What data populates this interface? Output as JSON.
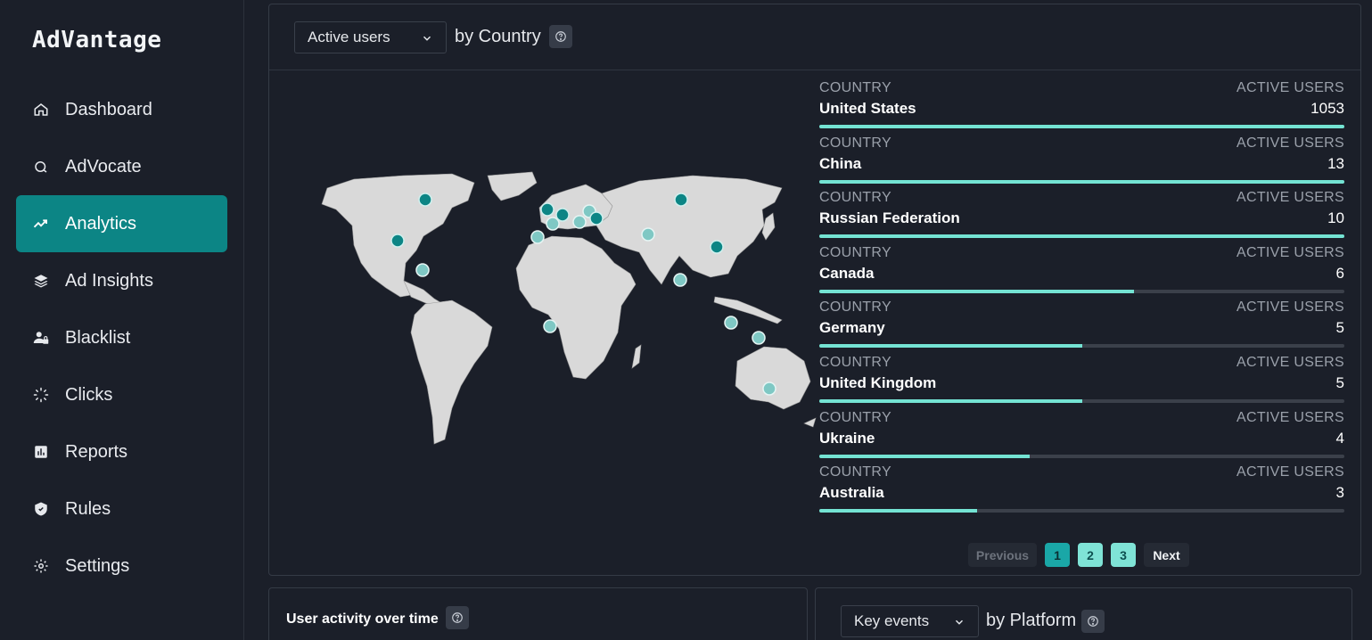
{
  "app": {
    "name": "AdVantage"
  },
  "sidebar": {
    "items": [
      {
        "label": "Dashboard",
        "icon": "home-icon"
      },
      {
        "label": "AdVocate",
        "icon": "chat-icon"
      },
      {
        "label": "Analytics",
        "icon": "trend-icon",
        "active": true
      },
      {
        "label": "Ad Insights",
        "icon": "layers-icon"
      },
      {
        "label": "Blacklist",
        "icon": "user-lock-icon"
      },
      {
        "label": "Clicks",
        "icon": "spinner-icon"
      },
      {
        "label": "Reports",
        "icon": "bar-chart-icon"
      },
      {
        "label": "Rules",
        "icon": "shield-icon"
      },
      {
        "label": "Settings",
        "icon": "gear-icon"
      }
    ]
  },
  "country_panel": {
    "metric_selected": "Active users",
    "by_label": "by Country",
    "col_country": "COUNTRY",
    "col_metric": "ACTIVE USERS",
    "rows": [
      {
        "country": "United States",
        "value": "1053",
        "fraction": 1.0
      },
      {
        "country": "China",
        "value": "13",
        "fraction": 1.0
      },
      {
        "country": "Russian Federation",
        "value": "10",
        "fraction": 1.0
      },
      {
        "country": "Canada",
        "value": "6",
        "fraction": 0.6
      },
      {
        "country": "Germany",
        "value": "5",
        "fraction": 0.5
      },
      {
        "country": "United Kingdom",
        "value": "5",
        "fraction": 0.5
      },
      {
        "country": "Ukraine",
        "value": "4",
        "fraction": 0.4
      },
      {
        "country": "Australia",
        "value": "3",
        "fraction": 0.3
      }
    ],
    "pager": {
      "previous": "Previous",
      "pages": [
        "1",
        "2",
        "3"
      ],
      "current": "1",
      "next": "Next"
    }
  },
  "activity_card": {
    "title": "User activity over time"
  },
  "platform_card": {
    "metric_selected": "Key events",
    "by_label": "by Platform"
  },
  "colors": {
    "accent": "#0c8585",
    "bar": "#74e3d3",
    "marker_dark": "#0c8585",
    "marker_light": "#7fc8c4"
  }
}
